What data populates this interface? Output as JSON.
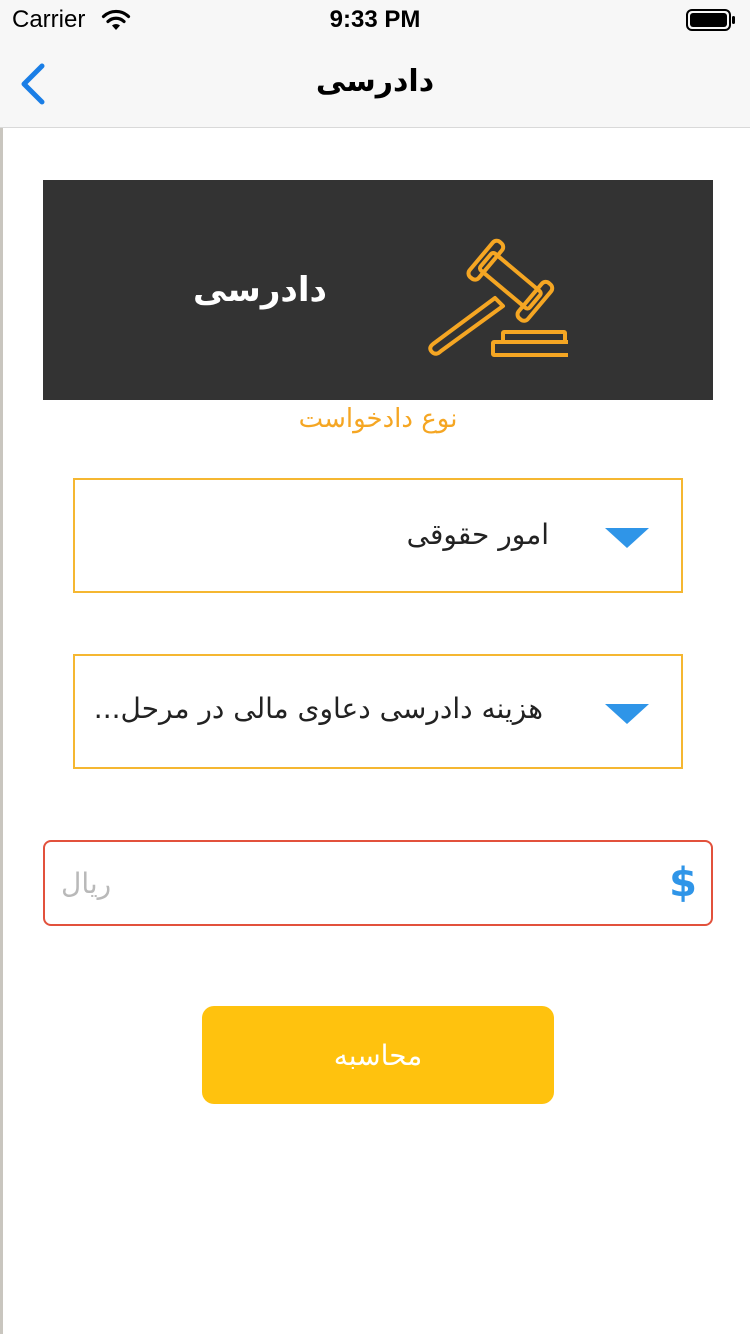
{
  "status_bar": {
    "carrier": "Carrier",
    "time": "9:33 PM",
    "icons": [
      "wifi-icon",
      "battery-icon"
    ]
  },
  "nav": {
    "title": "دادرسی",
    "back_icon": "chevron-left-icon",
    "accent": "#1a7ee6"
  },
  "banner": {
    "title": "دادرسی",
    "icon": "gavel-icon",
    "background": "#333333",
    "icon_color": "#f5a623"
  },
  "form": {
    "section_label": "نوع دادخواست",
    "dropdown_1": {
      "value": "امور حقوقی",
      "icon": "caret-down-icon"
    },
    "dropdown_2": {
      "value": "هزینه دادرسی دعاوی مالی در مرحل...",
      "icon": "caret-down-icon"
    },
    "amount": {
      "placeholder": "ریال",
      "value": "",
      "icon": "dollar-icon"
    },
    "calculate_label": "محاسبه"
  },
  "colors": {
    "accent_orange": "#f5a623",
    "dropdown_border": "#f5b731",
    "caret_blue": "#2f95e8",
    "error_border": "#e2513c",
    "button_yellow": "#ffc20e"
  }
}
